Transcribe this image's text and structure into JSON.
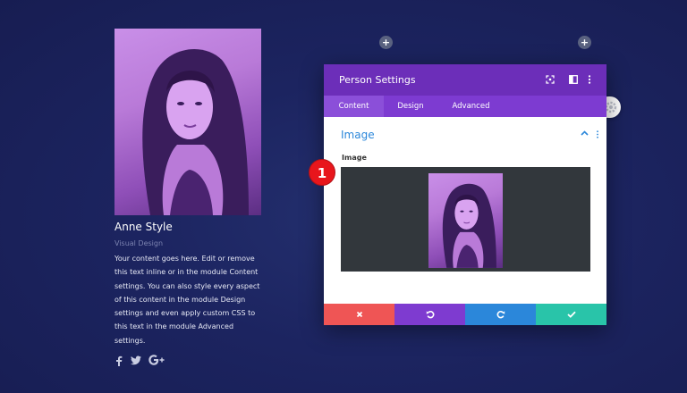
{
  "person": {
    "name": "Anne Style",
    "position": "Visual Design",
    "bio_lines": [
      "Your content goes here. Edit or remove",
      "this text inline or in the module Content",
      "settings. You can also style every aspect",
      "of this content in the module Design",
      "settings and even apply custom CSS to",
      "this text in the module Advanced",
      "settings."
    ],
    "social_icons": [
      "facebook-icon",
      "twitter-icon",
      "google-plus-icon"
    ]
  },
  "modal": {
    "title": "Person Settings",
    "header_icons": [
      "expand-icon",
      "sidebar-icon",
      "more-options-icon"
    ],
    "tabs": [
      {
        "label": "Content",
        "active": true
      },
      {
        "label": "Design",
        "active": false
      },
      {
        "label": "Advanced",
        "active": false
      }
    ],
    "section": {
      "title": "Image",
      "field_label": "Image"
    },
    "footer_buttons": [
      {
        "name": "cancel",
        "icon": "close-icon",
        "color": "#ef5555"
      },
      {
        "name": "undo",
        "icon": "undo-icon",
        "color": "#7e3bd0"
      },
      {
        "name": "redo",
        "icon": "redo-icon",
        "color": "#2b87da"
      },
      {
        "name": "save",
        "icon": "check-icon",
        "color": "#29c4a9"
      }
    ]
  },
  "step_badge": "1",
  "add_buttons": [
    "+",
    "+"
  ],
  "colors": {
    "page_background": "#1c2460",
    "modal_header": "#6c2eb9",
    "tab_bar": "#7d3bd1",
    "section_title": "#2b87da",
    "badge": "#e8161c"
  }
}
